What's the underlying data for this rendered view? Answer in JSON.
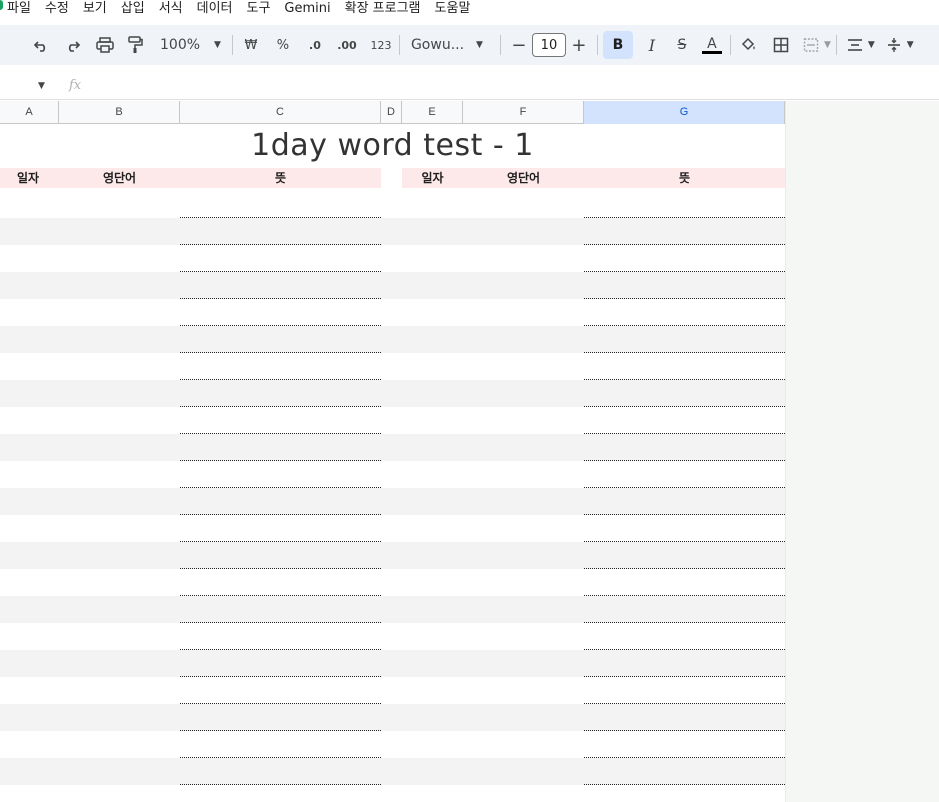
{
  "menu": {
    "items": [
      "파일",
      "수정",
      "보기",
      "삽입",
      "서식",
      "데이터",
      "도구",
      "Gemini",
      "확장 프로그램",
      "도움말"
    ]
  },
  "toolbar": {
    "zoom": "100%",
    "currency": "₩",
    "percent": "%",
    "decrease_decimal": ".0",
    "increase_decimal": ".00",
    "number_format": "123",
    "font": "Gowu...",
    "font_size": "10",
    "bold": "B",
    "italic": "I",
    "strike": "S",
    "text_color": "A"
  },
  "formula_bar": {
    "fx": "fx"
  },
  "columns": [
    "A",
    "B",
    "C",
    "D",
    "E",
    "F",
    "G"
  ],
  "selected_column": "G",
  "sheet": {
    "title": "1day word test - 1",
    "left_headers": [
      "일자",
      "영단어",
      "뜻"
    ],
    "right_headers": [
      "일자",
      "영단어",
      "뜻"
    ],
    "row_count": 22
  },
  "colors": {
    "header_fill": "#fde8ea",
    "row_shade": "#f3f3f3",
    "selected_col": "#d3e3fd",
    "toolbar_bg": "#f0f4f9"
  }
}
